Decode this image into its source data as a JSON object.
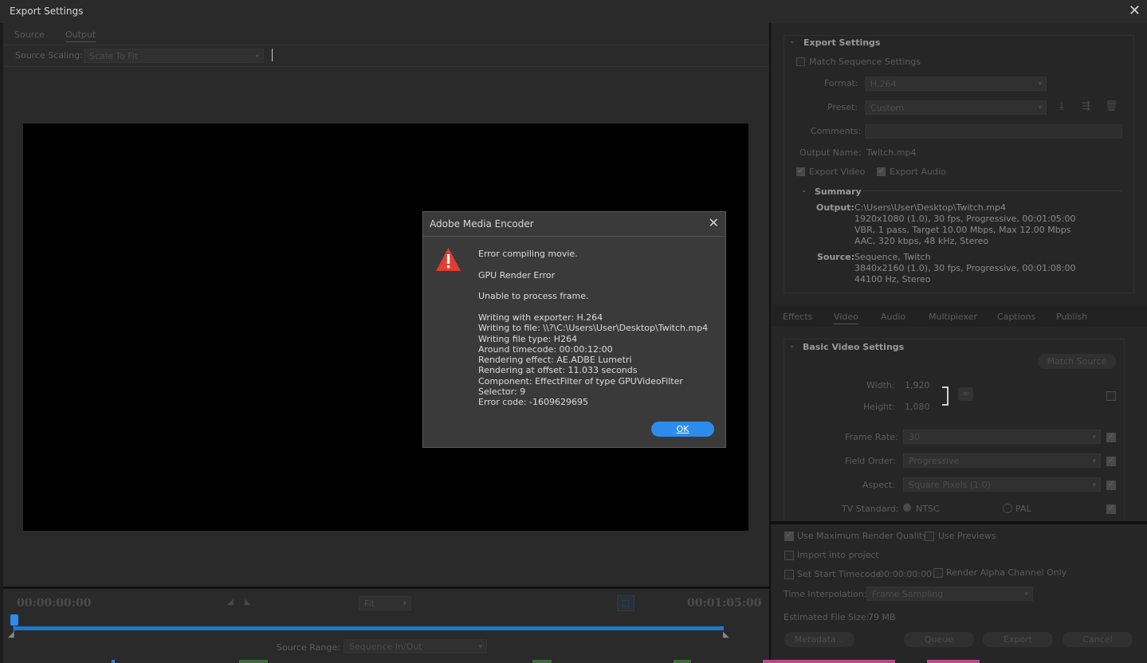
{
  "window": {
    "title": "Export Settings",
    "close_glyph": "✕"
  },
  "left": {
    "tabs": [
      "Source",
      "Output"
    ],
    "source_scaling_label": "Source Scaling:",
    "source_scaling_value": "Scale To Fit",
    "timeline": {
      "current_time": "00:00:00:00",
      "end_time": "00:01:05:00",
      "zoom_value": "Fit",
      "source_range_label": "Source Range:",
      "source_range_value": "Sequence In/Out"
    }
  },
  "dialog": {
    "title": "Adobe Media Encoder",
    "close_glyph": "✕",
    "heading": "Error compiling movie.",
    "line2": "GPU Render Error",
    "line3": "Unable to process frame.",
    "details": [
      "Writing with exporter: H.264",
      "Writing to file: \\\\?\\C:\\Users\\User\\Desktop\\Twitch.mp4",
      "Writing file type: H264",
      "Around timecode: 00:00:12:00",
      "Rendering effect: AE.ADBE Lumetri",
      "Rendering at offset: 11.033 seconds",
      "Component: EffectFilter of type GPUVideoFilter",
      "Selector: 9",
      "Error code: -1609629695"
    ],
    "ok_label": "OK",
    "warning_color": "#e03c31"
  },
  "right": {
    "export_settings_title": "Export Settings",
    "match_sequence_label": "Match Sequence Settings",
    "format_label": "Format:",
    "format_value": "H.264",
    "preset_label": "Preset:",
    "preset_value": "Custom",
    "comments_label": "Comments:",
    "output_name_label": "Output Name:",
    "output_name_value": "Twitch.mp4",
    "export_video_label": "Export Video",
    "export_audio_label": "Export Audio",
    "summary_title": "Summary",
    "summary_output_label": "Output:",
    "summary_output_lines": [
      "C:\\Users\\User\\Desktop\\Twitch.mp4",
      "1920x1080 (1.0), 30 fps, Progressive, 00:01:05:00",
      "VBR, 1 pass, Target 10.00 Mbps, Max 12.00 Mbps",
      "AAC, 320 kbps, 48 kHz, Stereo"
    ],
    "summary_source_label": "Source:",
    "summary_source_lines": [
      "Sequence, Twitch",
      "3840x2160 (1.0), 30 fps, Progressive, 00:01:08:00",
      "44100 Hz, Stereo"
    ],
    "tabs": [
      "Effects",
      "Video",
      "Audio",
      "Multiplexer",
      "Captions",
      "Publish"
    ],
    "basic_video_title": "Basic Video Settings",
    "match_source_label": "Match Source",
    "width_label": "Width:",
    "width_value": "1,920",
    "height_label": "Height:",
    "height_value": "1,080",
    "frame_rate_label": "Frame Rate:",
    "frame_rate_value": "30",
    "field_order_label": "Field Order:",
    "field_order_value": "Progressive",
    "aspect_label": "Aspect:",
    "aspect_value": "Square Pixels (1.0)",
    "tv_standard_label": "TV Standard:",
    "ntsc_label": "NTSC",
    "pal_label": "PAL",
    "use_max_render_label": "Use Maximum Render Quality",
    "use_previews_label": "Use Previews",
    "import_project_label": "Import into project",
    "set_start_tc_label": "Set Start Timecode",
    "start_tc_value": "00:00:00:00",
    "render_alpha_label": "Render Alpha Channel Only",
    "time_interp_label": "Time Interpolation:",
    "time_interp_value": "Frame Sampling",
    "est_size_label": "Estimated File Size:",
    "est_size_value": "79 MB",
    "metadata_label": "Metadata...",
    "queue_label": "Queue",
    "export_label": "Export",
    "cancel_label": "Cancel"
  },
  "colors": {
    "accent_blue": "#2d8ceb",
    "timeline_bar": "#1e78c8"
  }
}
